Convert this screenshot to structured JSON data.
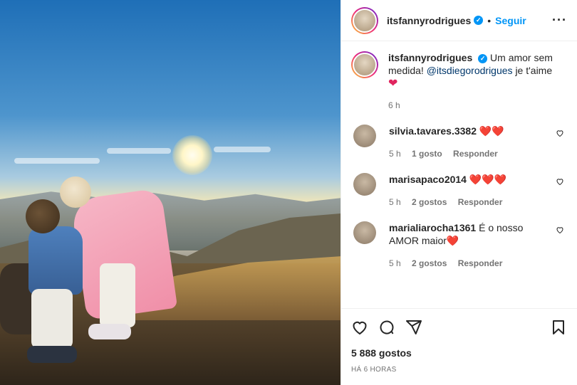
{
  "post": {
    "username": "itsfannyrodrigues",
    "follow_label": "Seguir",
    "caption_text": "Um amor sem medida!",
    "mention": "@itsdiegorodrigues",
    "caption_tail": "je t'aime",
    "caption_time": "6 h",
    "likes_label": "5 888 gostos",
    "ago_label": "HÁ 6 HORAS"
  },
  "comments": [
    {
      "username": "silvia.tavares.3382",
      "text": "❤️❤️",
      "time": "5 h",
      "likes": "1 gosto",
      "reply": "Responder"
    },
    {
      "username": "marisapaco2014",
      "text": "❤️❤️❤️",
      "time": "5 h",
      "likes": "2 gostos",
      "reply": "Responder"
    },
    {
      "username": "marialiarocha1361",
      "text": "É o nosso AMOR maior❤️",
      "time": "5 h",
      "likes": "2 gostos",
      "reply": "Responder"
    }
  ],
  "colors": {
    "accent": "#0095f6",
    "text": "#262626",
    "muted": "#737373",
    "heart": "#e0245e"
  }
}
